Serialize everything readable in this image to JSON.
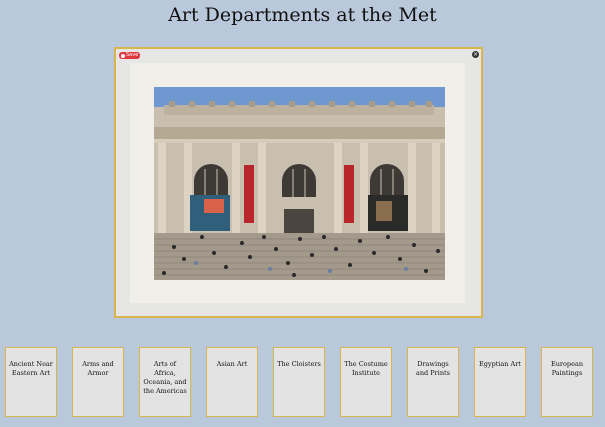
{
  "page": {
    "title": "Art Departments at the Met"
  },
  "modal": {
    "save_label": "Save",
    "close_icon": "close-icon",
    "image_subject": "Metropolitan Museum of Art facade"
  },
  "departments": [
    {
      "label": "Ancient Near Eastern Art"
    },
    {
      "label": "Arms and Armor"
    },
    {
      "label": "Arts of Africa, Oceania, and the Americas"
    },
    {
      "label": "Asian Art"
    },
    {
      "label": "The Cloisters"
    },
    {
      "label": "The Costume Institute"
    },
    {
      "label": "Drawings and Prints"
    },
    {
      "label": "Egyptian Art"
    },
    {
      "label": "European Paintings"
    }
  ],
  "colors": {
    "background": "#b9c9db",
    "frame_border": "#d9b54e",
    "card_bg": "#e3e3e3",
    "save_badge": "#e0373f"
  }
}
